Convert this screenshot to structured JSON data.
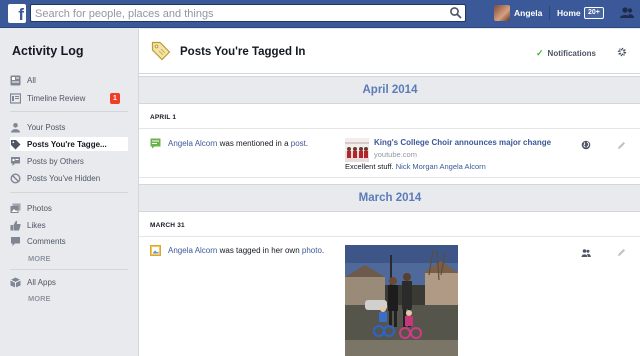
{
  "topbar": {
    "logo": "f",
    "search_placeholder": "Search for people, places and things",
    "user_name": "Angela",
    "home_label": "Home",
    "home_count": "20+"
  },
  "sidebar": {
    "title": "Activity Log",
    "groups": [
      [
        {
          "label": "All",
          "icon": "news-feed-icon"
        },
        {
          "label": "Timeline Review",
          "icon": "timeline-review-icon",
          "badge": "1"
        }
      ],
      [
        {
          "label": "Your Posts",
          "icon": "person-icon"
        },
        {
          "label": "Posts You're Tagge...",
          "icon": "tag-icon",
          "active": true
        },
        {
          "label": "Posts by Others",
          "icon": "comment-icon"
        },
        {
          "label": "Posts You've Hidden",
          "icon": "hidden-icon"
        }
      ],
      [
        {
          "label": "Photos",
          "icon": "photos-icon"
        },
        {
          "label": "Likes",
          "icon": "like-icon"
        },
        {
          "label": "Comments",
          "icon": "comments-icon"
        }
      ],
      [
        {
          "label": "All Apps",
          "icon": "apps-icon"
        }
      ]
    ],
    "more_label": "MORE"
  },
  "main": {
    "title": "Posts You're Tagged In",
    "notifications_label": "Notifications",
    "months": [
      "April 2014",
      "March 2014"
    ],
    "days": [
      "APRIL 1",
      "MARCH 31"
    ],
    "entry1": {
      "actor": "Angela Alcorn",
      "middle": " was mentioned in a ",
      "object": "post",
      "end": ".",
      "story_title": "King's College Choir announces major change",
      "story_domain": "youtube.com",
      "comment_text": "Excellent stuff. ",
      "comment_names": "Nick Morgan Angela Alcorn"
    },
    "entry2": {
      "actor": "Angela Alcorn",
      "middle": " was tagged in her own ",
      "object": "photo",
      "end": "."
    }
  },
  "colors": {
    "brand_blue": "#3b5998",
    "badge_red": "#f03d25",
    "check_green": "#42b72a",
    "month_blue": "#5b7bb8"
  }
}
